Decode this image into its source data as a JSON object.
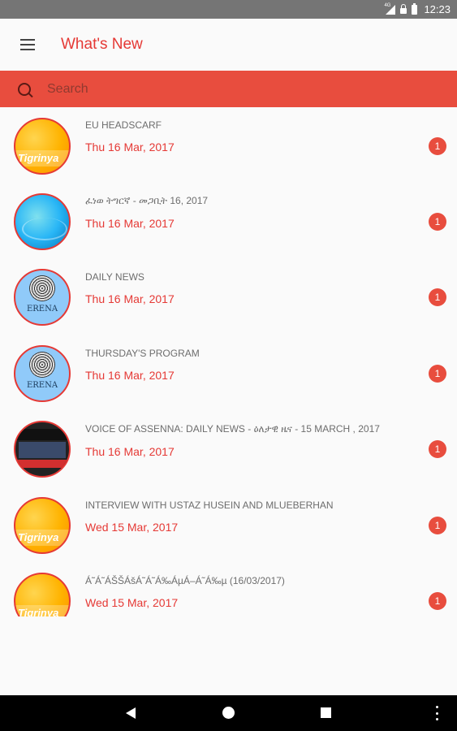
{
  "status": {
    "clock": "12:23",
    "signal_label": "4G"
  },
  "appbar": {
    "title": "What's New"
  },
  "search": {
    "placeholder": "Search"
  },
  "items": [
    {
      "title": "EU HEADSCARF",
      "date": "Thu 16 Mar, 2017",
      "badge": "1",
      "avatar": "tigrinya-logo"
    },
    {
      "title": "ፈነወ ትግርኛ - መጋቢት 16, 2017",
      "date": "Thu 16 Mar, 2017",
      "badge": "1",
      "avatar": "globe-logo"
    },
    {
      "title": "DAILY NEWS",
      "date": "Thu 16 Mar, 2017",
      "badge": "1",
      "avatar": "erena-logo",
      "avatar_text": "ERENA"
    },
    {
      "title": "THURSDAY'S PROGRAM",
      "date": "Thu 16 Mar, 2017",
      "badge": "1",
      "avatar": "erena-logo",
      "avatar_text": "ERENA"
    },
    {
      "title": "VOICE OF ASSENNA: DAILY NEWS - ዕለታዊ ዜና - 15 MARCH , 2017",
      "date": "Thu 16 Mar, 2017",
      "badge": "1",
      "avatar": "assenna-logo"
    },
    {
      "title": "INTERVIEW WITH USTAZ HUSEIN AND MLUEBERHAN",
      "date": "Wed 15 Mar, 2017",
      "badge": "1",
      "avatar": "tigrinya-logo"
    },
    {
      "title": "Á˜Á˜ÁŠŠÁšÁ˜Á˜Á‰ÁµÁ–Á˜Á‰µ (16/03/2017)",
      "date": "Wed 15 Mar, 2017",
      "badge": "1",
      "avatar": "tigrinya-logo"
    }
  ],
  "avatar_text": {
    "tigrinya": "Tigrinya"
  },
  "colors": {
    "accent": "#e53935",
    "search_bar": "#e84d3e",
    "status_bar": "#757575"
  }
}
